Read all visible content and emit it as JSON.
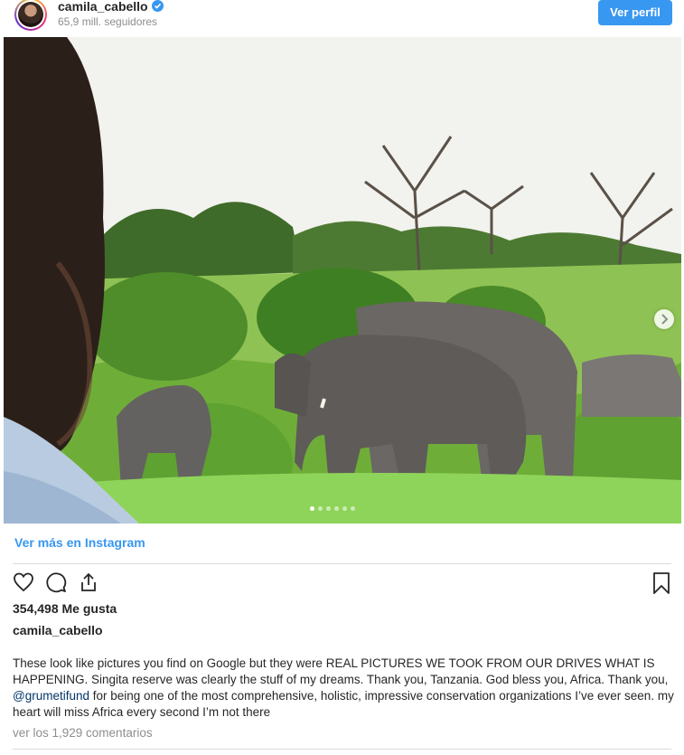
{
  "header": {
    "username": "camila_cabello",
    "followers": "65,9 mill. seguidores",
    "profile_button": "Ver perfil",
    "verified_icon": "verified-badge-icon"
  },
  "carousel": {
    "slide_count": 6,
    "active_index": 0
  },
  "links": {
    "view_more": "Ver más en Instagram"
  },
  "actions": {
    "icons": [
      "heart-icon",
      "comment-icon",
      "share-icon",
      "bookmark-icon"
    ]
  },
  "post": {
    "likes": "354,498 Me gusta",
    "author": "camila_cabello",
    "caption_part1": "These look like pictures you find on Google but they were REAL PICTURES WE TOOK FROM OUR DRIVES WHAT IS HAPPENING. Singita reserve was clearly the stuff of my dreams. Thank you, Tanzania. God bless you, Africa. Thank you, ",
    "mention": "@grumetifund",
    "caption_part2": " for being one of the most comprehensive, holistic, impressive conservation organizations I’ve ever seen. my heart will miss Africa every second I’m not there",
    "comments_link": "ver los 1,929 comentarios"
  },
  "colors": {
    "accent": "#3897f0",
    "text": "#262626",
    "muted": "#8e8e8e",
    "mention": "#003569"
  }
}
